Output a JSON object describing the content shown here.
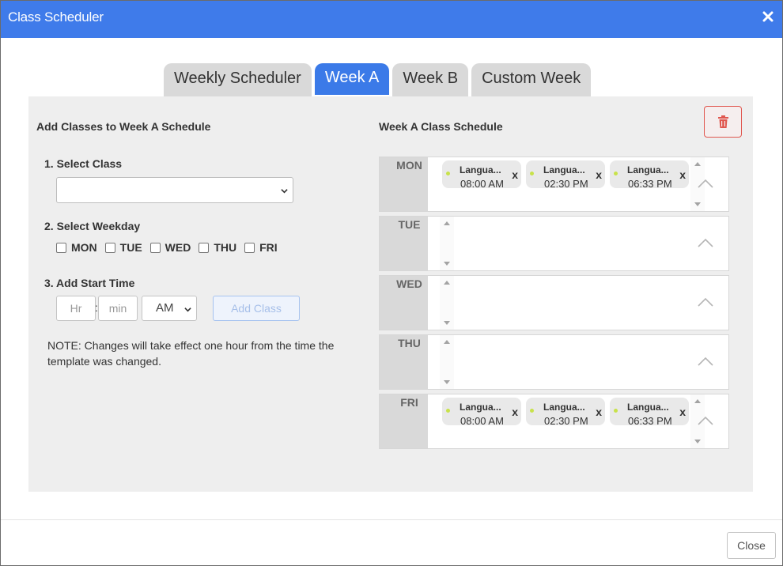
{
  "window": {
    "title": "Class Scheduler"
  },
  "tabs": [
    {
      "label": "Weekly Scheduler",
      "active": false
    },
    {
      "label": "Week A",
      "active": true
    },
    {
      "label": "Week B",
      "active": false
    },
    {
      "label": "Custom Week",
      "active": false
    }
  ],
  "left": {
    "title": "Add Classes to Week A Schedule",
    "step1": "1. Select Class",
    "select_class_value": "",
    "step2": "2. Select Weekday",
    "weekdays": [
      "MON",
      "TUE",
      "WED",
      "THU",
      "FRI"
    ],
    "step3": "3. Add Start Time",
    "hr_placeholder": "Hr",
    "min_placeholder": "min",
    "ampm_value": "AM",
    "add_button": "Add Class",
    "note": "NOTE: Changes will take effect one hour from the time the template was changed."
  },
  "right": {
    "title": "Week A Class Schedule",
    "days": [
      {
        "label": "MON",
        "classes": [
          {
            "name": "Langua...",
            "time": "08:00 AM"
          },
          {
            "name": "Langua...",
            "time": "02:30 PM"
          },
          {
            "name": "Langua...",
            "time": "06:33 PM"
          }
        ]
      },
      {
        "label": "TUE",
        "classes": []
      },
      {
        "label": "WED",
        "classes": []
      },
      {
        "label": "THU",
        "classes": []
      },
      {
        "label": "FRI",
        "classes": [
          {
            "name": "Langua...",
            "time": "08:00 AM"
          },
          {
            "name": "Langua...",
            "time": "02:30 PM"
          },
          {
            "name": "Langua...",
            "time": "06:33 PM"
          }
        ]
      }
    ],
    "chip_remove": "x"
  },
  "footer": {
    "close_button": "Close"
  },
  "colors": {
    "accent": "#3b7ae8",
    "titlebar": "#3f7bea",
    "delete": "#e0574f",
    "class_dot": "#c8e24a"
  }
}
